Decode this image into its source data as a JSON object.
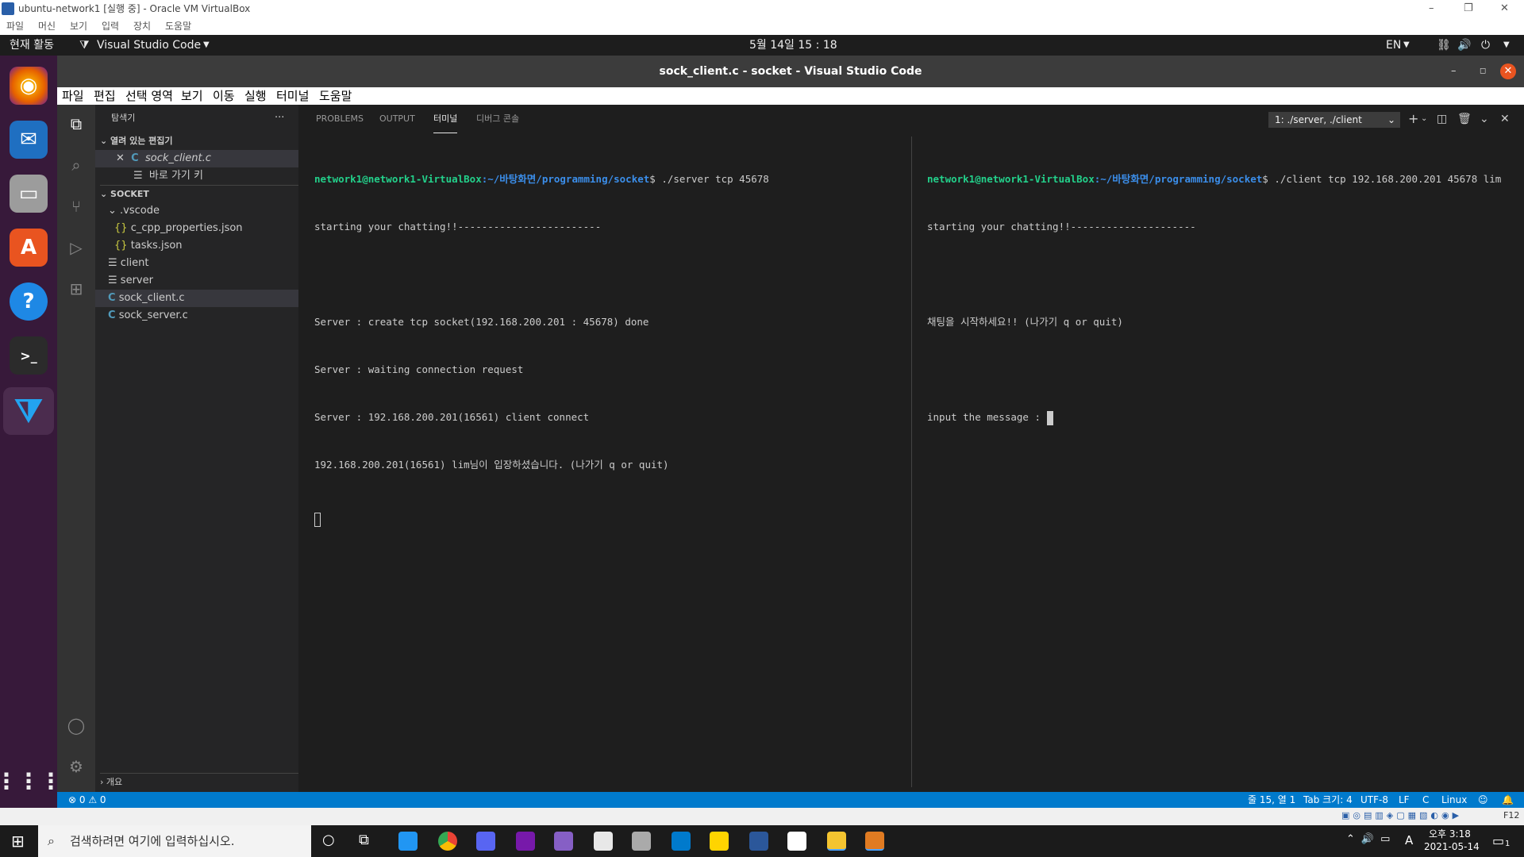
{
  "vbox": {
    "title": "ubuntu-network1 [실행 중] - Oracle VM VirtualBox",
    "menu": [
      "파일",
      "머신",
      "보기",
      "입력",
      "장치",
      "도움말"
    ]
  },
  "ubuntu": {
    "activities": "현재 활동",
    "app": "Visual Studio Code",
    "clock": "5월 14일  15 : 18",
    "lang": "EN"
  },
  "vscode": {
    "title": "sock_client.c - socket - Visual Studio Code",
    "menu": [
      "파일",
      "편집",
      "선택 영역",
      "보기",
      "이동",
      "실행",
      "터미널",
      "도움말"
    ],
    "sidebar": {
      "header": "탐색기",
      "open_editors": "열려 있는 편집기",
      "open_files": [
        "sock_client.c",
        "바로 가기 키"
      ],
      "folder": "SOCKET",
      "tree": [
        ".vscode",
        "c_cpp_properties.json",
        "tasks.json",
        "client",
        "server",
        "sock_client.c",
        "sock_server.c"
      ],
      "outline": "개요"
    },
    "panel": {
      "tabs": [
        "PROBLEMS",
        "OUTPUT",
        "터미널",
        "디버그 콘솔"
      ],
      "terminal_select": "1: ./server, ./client",
      "left": {
        "prompt_user": "network1@network1-VirtualBox",
        "prompt_path": ":~/바탕화면/programming/socket",
        "command": "$ ./server tcp 45678",
        "lines": [
          "starting your chatting!!------------------------",
          "",
          "Server : create tcp socket(192.168.200.201 : 45678) done",
          "Server : waiting connection request",
          "Server : 192.168.200.201(16561) client connect",
          "192.168.200.201(16561) lim님이 입장하셨습니다. (나가기 q or quit)"
        ]
      },
      "right": {
        "prompt_user": "network1@network1-VirtualBox",
        "prompt_path": ":~/바탕화면/programming/socket",
        "command": "$ ./client tcp 192.168.200.201 45678 lim",
        "lines": [
          "starting your chatting!!---------------------",
          "",
          "채팅을 시작하세요!! (나가기 q or quit)",
          "",
          "input the message : "
        ]
      }
    },
    "status": {
      "problems": "⊗ 0 ⚠ 0",
      "position": "줄 15, 열 1",
      "tab": "Tab 크기: 4",
      "encoding": "UTF-8",
      "eol": "LF",
      "lang": "C",
      "os": "Linux"
    }
  },
  "windows": {
    "search_placeholder": "검색하려면 여기에 입력하십시오.",
    "time": "오후 3:18",
    "date": "2021-05-14",
    "ime": "A",
    "notif": "1",
    "f12": "F12"
  }
}
